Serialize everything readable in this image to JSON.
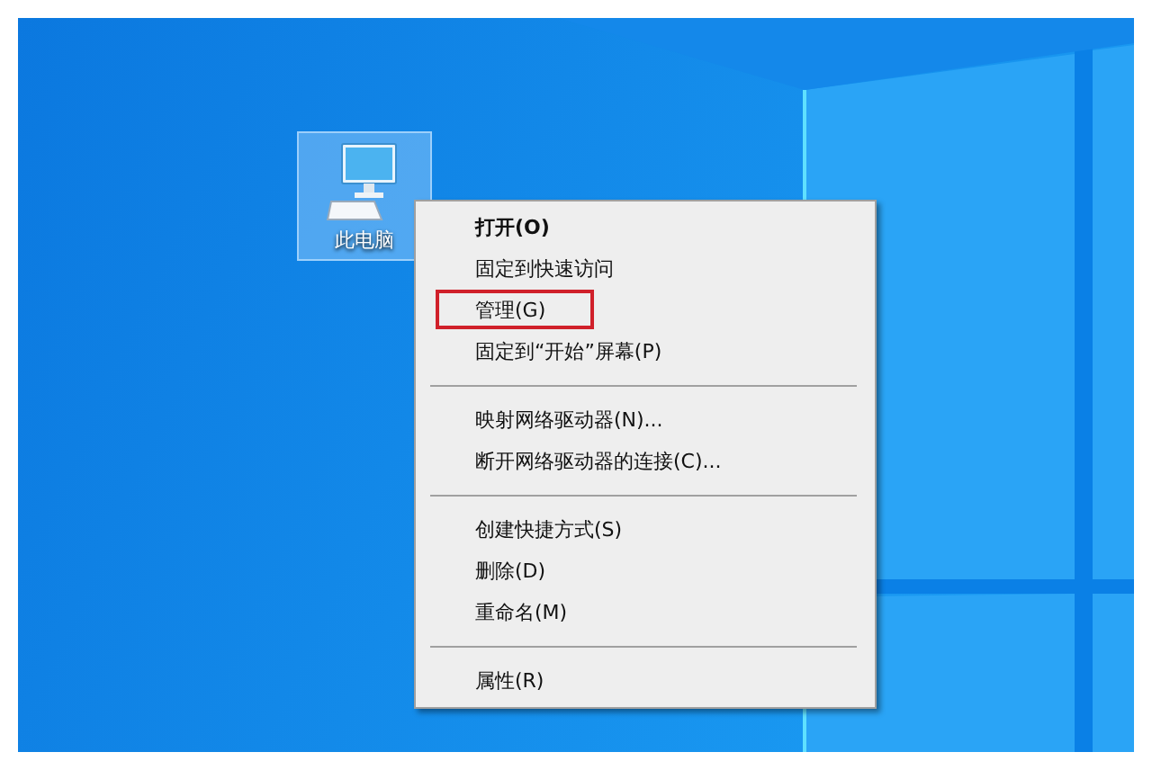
{
  "desktop": {
    "icons": [
      {
        "label": "此电脑",
        "selected": true
      }
    ]
  },
  "context_menu": {
    "items": [
      {
        "kind": "item",
        "label": "打开(O)",
        "bold": true,
        "annotated": false
      },
      {
        "kind": "item",
        "label": "固定到快速访问",
        "bold": false,
        "annotated": false
      },
      {
        "kind": "item",
        "label": "管理(G)",
        "bold": false,
        "annotated": true
      },
      {
        "kind": "item",
        "label": "固定到“开始”屏幕(P)",
        "bold": false,
        "annotated": false
      },
      {
        "kind": "separator"
      },
      {
        "kind": "item",
        "label": "映射网络驱动器(N)...",
        "bold": false,
        "annotated": false
      },
      {
        "kind": "item",
        "label": "断开网络驱动器的连接(C)...",
        "bold": false,
        "annotated": false
      },
      {
        "kind": "separator"
      },
      {
        "kind": "item",
        "label": "创建快捷方式(S)",
        "bold": false,
        "annotated": false
      },
      {
        "kind": "item",
        "label": "删除(D)",
        "bold": false,
        "annotated": false
      },
      {
        "kind": "item",
        "label": "重命名(M)",
        "bold": false,
        "annotated": false
      },
      {
        "kind": "separator"
      },
      {
        "kind": "item",
        "label": "属性(R)",
        "bold": false,
        "annotated": false
      }
    ]
  }
}
